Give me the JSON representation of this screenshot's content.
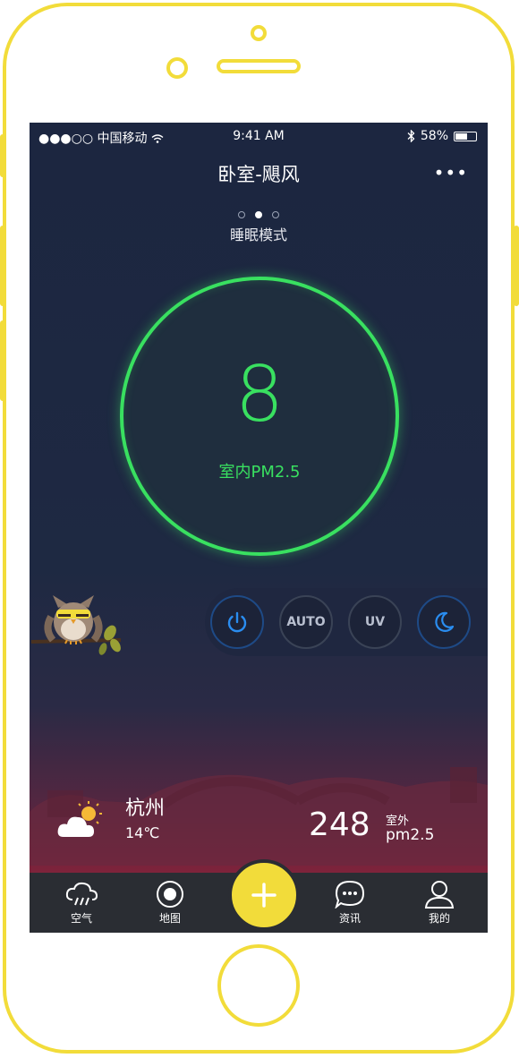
{
  "status_bar": {
    "carrier": "●●●○○ 中国移动",
    "time": "9:41 AM",
    "battery": "58%"
  },
  "header": {
    "title": "卧室-飓风",
    "more": "•••"
  },
  "pager": {
    "count": 3,
    "active": 2
  },
  "mode": {
    "label": "睡眠模式"
  },
  "indoor": {
    "value": "8",
    "label": "室内PM2.5",
    "color": "#39e060"
  },
  "controls": [
    {
      "label": "",
      "icon": "power-icon"
    },
    {
      "label": "AUTO",
      "icon": ""
    },
    {
      "label": "UV",
      "icon": ""
    },
    {
      "label": "",
      "icon": "moon-icon"
    }
  ],
  "weather": {
    "city": "杭州",
    "temp": "14℃",
    "icon": "partly-cloudy-icon"
  },
  "outdoor": {
    "value": "248",
    "label_top": "室外",
    "label_bottom": "pm2.5"
  },
  "tabs": [
    {
      "label": "空气",
      "icon": "rain-cloud-icon"
    },
    {
      "label": "地图",
      "icon": "location-icon"
    },
    {
      "label": "资讯",
      "icon": "chat-bubble-icon"
    },
    {
      "label": "我的",
      "icon": "user-icon"
    }
  ],
  "fab": {
    "icon": "plus-icon",
    "color": "#f2dc3a"
  }
}
